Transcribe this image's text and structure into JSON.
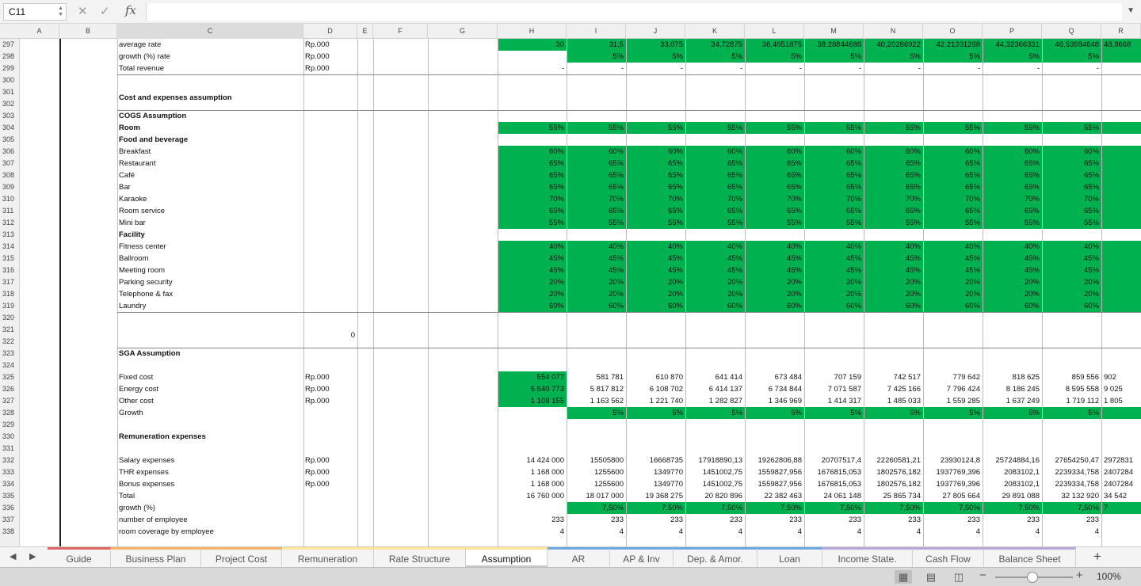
{
  "formula_bar": {
    "name_box": "C11",
    "fx_label": "fx",
    "formula": ""
  },
  "columns": [
    "A",
    "B",
    "C",
    "D",
    "E",
    "F",
    "G",
    "H",
    "I",
    "J",
    "K",
    "L",
    "M",
    "N",
    "O",
    "P",
    "Q",
    "R"
  ],
  "row_numbers": [
    "297",
    "298",
    "299",
    "300",
    "301",
    "302",
    "303",
    "304",
    "305",
    "306",
    "307",
    "308",
    "309",
    "310",
    "311",
    "312",
    "313",
    "314",
    "315",
    "316",
    "317",
    "318",
    "319",
    "320",
    "321",
    "322",
    "323",
    "324",
    "325",
    "326",
    "327",
    "328",
    "329",
    "330",
    "331",
    "332",
    "333",
    "334",
    "335",
    "336",
    "337",
    "338"
  ],
  "rows": [
    {
      "n": "297",
      "label": "average rate",
      "unit": "Rp.000",
      "fill": "H",
      "vals": [
        "30",
        "31,5",
        "33,075",
        "34,72875",
        "36,4651875",
        "38,28844688",
        "40,20286922",
        "42,21301268",
        "44,32366331",
        "46,53984648",
        "48,8668"
      ]
    },
    {
      "n": "298",
      "label": "growth (%) rate",
      "unit": "Rp.000",
      "fill": "I",
      "vals": [
        "",
        "5%",
        "5%",
        "5%",
        "5%",
        "5%",
        "5%",
        "5%",
        "5%",
        "5%",
        ""
      ]
    },
    {
      "n": "299",
      "label": "Total revenue",
      "unit": "Rp.000",
      "vals": [
        "-",
        "-",
        "-",
        "-",
        "-",
        "-",
        "-",
        "-",
        "-",
        "-",
        ""
      ]
    },
    {
      "n": "301",
      "label": "Cost and expenses assumption",
      "bold": true,
      "tall": true
    },
    {
      "n": "303",
      "label": "COGS Assumption",
      "bold": true
    },
    {
      "n": "304",
      "label": "Room",
      "bold": true,
      "fill": "H",
      "vals": [
        "55%",
        "55%",
        "55%",
        "55%",
        "55%",
        "55%",
        "55%",
        "55%",
        "55%",
        "55%",
        ""
      ]
    },
    {
      "n": "305",
      "label": "Food and beverage",
      "bold": true
    },
    {
      "n": "306",
      "label": "Breakfast",
      "fill": "H",
      "vals": [
        "60%",
        "60%",
        "60%",
        "60%",
        "60%",
        "60%",
        "60%",
        "60%",
        "60%",
        "60%",
        ""
      ]
    },
    {
      "n": "307",
      "label": "Restaurant",
      "fill": "H",
      "vals": [
        "65%",
        "65%",
        "65%",
        "65%",
        "65%",
        "65%",
        "65%",
        "65%",
        "65%",
        "65%",
        ""
      ]
    },
    {
      "n": "308",
      "label": "Café",
      "fill": "H",
      "vals": [
        "65%",
        "65%",
        "65%",
        "65%",
        "65%",
        "65%",
        "65%",
        "65%",
        "65%",
        "65%",
        ""
      ]
    },
    {
      "n": "309",
      "label": "Bar",
      "fill": "H",
      "vals": [
        "65%",
        "65%",
        "65%",
        "65%",
        "65%",
        "65%",
        "65%",
        "65%",
        "65%",
        "65%",
        ""
      ]
    },
    {
      "n": "310",
      "label": "Karaoke",
      "fill": "H",
      "vals": [
        "70%",
        "70%",
        "70%",
        "70%",
        "70%",
        "70%",
        "70%",
        "70%",
        "70%",
        "70%",
        ""
      ]
    },
    {
      "n": "311",
      "label": "Room service",
      "fill": "H",
      "vals": [
        "65%",
        "65%",
        "65%",
        "65%",
        "65%",
        "65%",
        "65%",
        "65%",
        "65%",
        "65%",
        ""
      ]
    },
    {
      "n": "312",
      "label": "Mini bar",
      "fill": "H",
      "vals": [
        "55%",
        "55%",
        "55%",
        "55%",
        "55%",
        "55%",
        "55%",
        "55%",
        "55%",
        "55%",
        ""
      ]
    },
    {
      "n": "313",
      "label": "Facility",
      "bold": true
    },
    {
      "n": "314",
      "label": "Fitness center",
      "fill": "H",
      "vals": [
        "40%",
        "40%",
        "40%",
        "40%",
        "40%",
        "40%",
        "40%",
        "40%",
        "40%",
        "40%",
        ""
      ]
    },
    {
      "n": "315",
      "label": "Ballroom",
      "fill": "H",
      "vals": [
        "45%",
        "45%",
        "45%",
        "45%",
        "45%",
        "45%",
        "45%",
        "45%",
        "45%",
        "45%",
        ""
      ]
    },
    {
      "n": "316",
      "label": "Meeting room",
      "fill": "H",
      "vals": [
        "45%",
        "45%",
        "45%",
        "45%",
        "45%",
        "45%",
        "45%",
        "45%",
        "45%",
        "45%",
        ""
      ]
    },
    {
      "n": "317",
      "label": "Parking security",
      "fill": "H",
      "vals": [
        "20%",
        "20%",
        "20%",
        "20%",
        "20%",
        "20%",
        "20%",
        "20%",
        "20%",
        "20%",
        ""
      ]
    },
    {
      "n": "318",
      "label": "Telephone & fax",
      "fill": "H",
      "vals": [
        "20%",
        "20%",
        "20%",
        "20%",
        "20%",
        "20%",
        "20%",
        "20%",
        "20%",
        "20%",
        ""
      ]
    },
    {
      "n": "319",
      "label": "Laundry",
      "fill": "H",
      "vals": [
        "60%",
        "60%",
        "60%",
        "60%",
        "60%",
        "60%",
        "60%",
        "60%",
        "60%",
        "60%",
        ""
      ]
    },
    {
      "n": "321",
      "label": "",
      "dval": "0",
      "tall": true
    },
    {
      "n": "323",
      "label": "SGA Assumption",
      "bold": true
    },
    {
      "n": "325",
      "label": "Fixed cost",
      "unit": "Rp.000",
      "fill": "Honly",
      "vals": [
        "554 077",
        "581 781",
        "610 870",
        "641 414",
        "673 484",
        "707 159",
        "742 517",
        "779 642",
        "818 625",
        "859 556",
        "902"
      ]
    },
    {
      "n": "326",
      "label": "Energy cost",
      "unit": "Rp.000",
      "fill": "Honly",
      "vals": [
        "5 540 773",
        "5 817 812",
        "6 108 702",
        "6 414 137",
        "6 734 844",
        "7 071 587",
        "7 425 166",
        "7 796 424",
        "8 186 245",
        "8 595 558",
        "9 025"
      ]
    },
    {
      "n": "327",
      "label": "Other cost",
      "unit": "Rp.000",
      "fill": "Honly",
      "vals": [
        "1 108 155",
        "1 163 562",
        "1 221 740",
        "1 282 827",
        "1 346 969",
        "1 414 317",
        "1 485 033",
        "1 559 285",
        "1 637 249",
        "1 719 112",
        "1 805"
      ]
    },
    {
      "n": "328",
      "label": "Growth",
      "fill": "I",
      "vals": [
        "",
        "5%",
        "5%",
        "5%",
        "5%",
        "5%",
        "5%",
        "5%",
        "5%",
        "5%",
        ""
      ]
    },
    {
      "n": "330",
      "label": "Remuneration expenses",
      "bold": true
    },
    {
      "n": "332",
      "label": "Salary expenses",
      "unit": "Rp.000",
      "vals": [
        "14 424 000",
        "15505800",
        "16668735",
        "17918890,13",
        "19262806,88",
        "20707517,4",
        "22260581,21",
        "23930124,8",
        "25724884,16",
        "27654250,47",
        "2972831"
      ]
    },
    {
      "n": "333",
      "label": "THR expenses",
      "unit": "Rp.000",
      "vals": [
        "1 168 000",
        "1255600",
        "1349770",
        "1451002,75",
        "1559827,956",
        "1676815,053",
        "1802576,182",
        "1937769,396",
        "2083102,1",
        "2239334,758",
        "2407284"
      ]
    },
    {
      "n": "334",
      "label": "Bonus expenses",
      "unit": "Rp.000",
      "vals": [
        "1 168 000",
        "1255600",
        "1349770",
        "1451002,75",
        "1559827,956",
        "1676815,053",
        "1802576,182",
        "1937769,396",
        "2083102,1",
        "2239334,758",
        "2407284"
      ]
    },
    {
      "n": "335",
      "label": "Total",
      "vals": [
        "16 760 000",
        "18 017 000",
        "19 368 275",
        "20 820 896",
        "22 382 463",
        "24 061 148",
        "25 865 734",
        "27 805 664",
        "29 891 088",
        "32 132 920",
        "34 542"
      ]
    },
    {
      "n": "336",
      "label": "growth (%)",
      "fill": "I",
      "vals": [
        "",
        "7,50%",
        "7,50%",
        "7,50%",
        "7,50%",
        "7,50%",
        "7,50%",
        "7,50%",
        "7,50%",
        "7,50%",
        "7"
      ]
    },
    {
      "n": "337",
      "label": "number of employee",
      "vals": [
        "233",
        "233",
        "233",
        "233",
        "233",
        "233",
        "233",
        "233",
        "233",
        "233",
        ""
      ]
    },
    {
      "n": "338",
      "label": "room coverage by employee",
      "vals": [
        "4",
        "4",
        "4",
        "4",
        "4",
        "4",
        "4",
        "4",
        "4",
        "4",
        ""
      ]
    }
  ],
  "sheet_tabs": [
    {
      "label": "Guide",
      "color": "#e06666"
    },
    {
      "label": "Business Plan",
      "color": "#f6b26b"
    },
    {
      "label": "Project Cost",
      "color": "#f6b26b"
    },
    {
      "label": "Remuneration",
      "color": "#ffe599"
    },
    {
      "label": "Rate Structure",
      "color": "#ffe599"
    },
    {
      "label": "Assumption",
      "color": "#ffe599"
    },
    {
      "label": "AR",
      "color": "#6fa8dc"
    },
    {
      "label": "AP & Inv",
      "color": "#6fa8dc"
    },
    {
      "label": "Dep. & Amor.",
      "color": "#6fa8dc"
    },
    {
      "label": "Loan",
      "color": "#6fa8dc"
    },
    {
      "label": "Income State.",
      "color": "#b4a7d6"
    },
    {
      "label": "Cash Flow",
      "color": "#b4a7d6"
    },
    {
      "label": "Balance Sheet",
      "color": "#b4a7d6"
    }
  ],
  "active_tab": "Assumption",
  "status": {
    "zoom": "100%"
  },
  "colors": {
    "fill": "#00b14f"
  }
}
